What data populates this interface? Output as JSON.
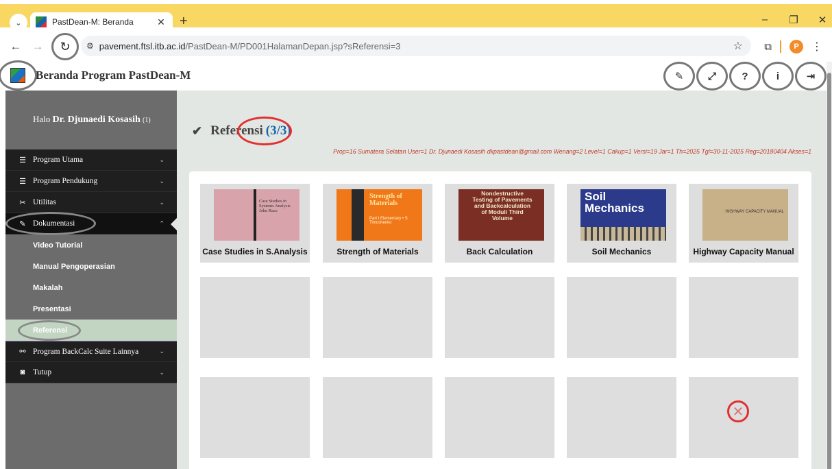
{
  "browser": {
    "tab_title": "PastDean-M: Beranda",
    "tab_close": "✕",
    "new_tab": "+",
    "url_host": "pavement.ftsl.itb.ac.id",
    "url_path": "/PastDean-M/PD001HalamanDepan.jsp?sReferensi=3",
    "profile_initial": "P"
  },
  "header": {
    "title": "Beranda Program PastDean-M",
    "actions": [
      "edit",
      "fullscreen",
      "help",
      "info",
      "logout"
    ]
  },
  "sidebar": {
    "greeting": "Halo",
    "user_name": "Dr. Djunaedi Kosasih",
    "user_suffix": "(1)",
    "items": [
      {
        "label": "Program Utama",
        "icon": "list-icon"
      },
      {
        "label": "Program Pendukung",
        "icon": "list-icon"
      },
      {
        "label": "Utilitas",
        "icon": "tools-icon"
      },
      {
        "label": "Dokumentasi",
        "icon": "pencil-icon",
        "expanded": true
      },
      {
        "label": "Program BackCalc Suite Lainnya",
        "icon": "link-icon"
      },
      {
        "label": "Tutup",
        "icon": "power-icon"
      }
    ],
    "subitems": [
      "Video Tutorial",
      "Manual Pengoperasian",
      "Makalah",
      "Presentasi",
      "Referensi"
    ]
  },
  "content": {
    "title": "Referensi",
    "count": "(3/3)",
    "meta": "Prop=16 Sumatera Selatan  User=1 Dr. Djunaedi Kosasih dkpastdean@gmail.com  Wenang=2  Level=1  Cakup=1  Versi=19  Jar=1  Th=2025  Tgl=30-11-2025  Reg=20180404  Akses=1",
    "books": [
      {
        "label": "Case Studies in S.Analysis",
        "cover_text": "Case Studies in Systems Analysis John Race"
      },
      {
        "label": "Strength of Materials",
        "cover_text": "Strength of Materials",
        "cover_sub": "Part I Elementary • S Timoshenko"
      },
      {
        "label": "Back Calculation",
        "cover_text": "Nondestructive Testing of Pavements and Backcalculation of Moduli Third Volume"
      },
      {
        "label": "Soil Mechanics",
        "cover_text": "Soil Mechanics"
      },
      {
        "label": "Highway Capacity Manual",
        "cover_text": "HIGHWAY CAPACITY MANUAL"
      }
    ]
  },
  "colors": {
    "tabstrip": "#f8d863",
    "sidebar_bg": "#6c6c6c",
    "sidebar_dark": "#1f1f1f",
    "content_bg": "#e3e7e3",
    "selected_sub": "#c2d5c2",
    "annotation_red": "#e03131",
    "link_blue": "#1864ab"
  }
}
